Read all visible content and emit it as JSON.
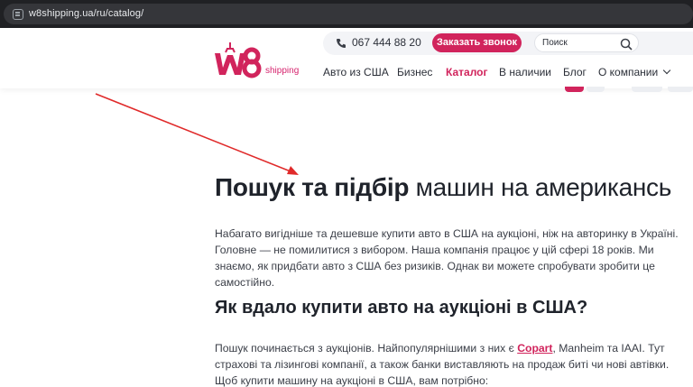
{
  "browser": {
    "url": "w8shipping.ua/ru/catalog/"
  },
  "header": {
    "logo_sub": "shipping",
    "phone": "067 444 88 20",
    "call_button": "Заказать звонок",
    "search_placeholder": "Поиск",
    "nav": [
      {
        "label": "Авто из США"
      },
      {
        "label": "Бизнес"
      },
      {
        "label": "Каталог",
        "active": true
      },
      {
        "label": "В наличии"
      },
      {
        "label": "Блог"
      },
      {
        "label": "О компании"
      }
    ]
  },
  "content": {
    "title_bold": "Пошук та підбір",
    "title_rest": " машин на американсь",
    "intro": "Набагато вигідніше та дешевше купити авто в США на аукціоні, ніж на авторинку в Україні. Головне — не помилитися з вибором. Наша компанія працює у цій сфері 18 років. Ми знаємо, як придбати авто з США без ризиків. Однак ви можете спробувати зробити це самостійно.",
    "subtitle": "Як вдало купити авто на аукціоні в США?",
    "para_before_link": "Пошук починається з аукціонів. Найпопулярнішими з них є ",
    "link": "Copart",
    "para_after_link": ", Manheim та IAAI. Тут страхові та лізингові компанії, а також банки виставляють на продаж биті чи нові автівки. Щоб купити машину на аукціоні в США, вам потрібно:"
  },
  "colors": {
    "accent": "#d1245c",
    "annotation_arrow": "#e02a2a"
  }
}
